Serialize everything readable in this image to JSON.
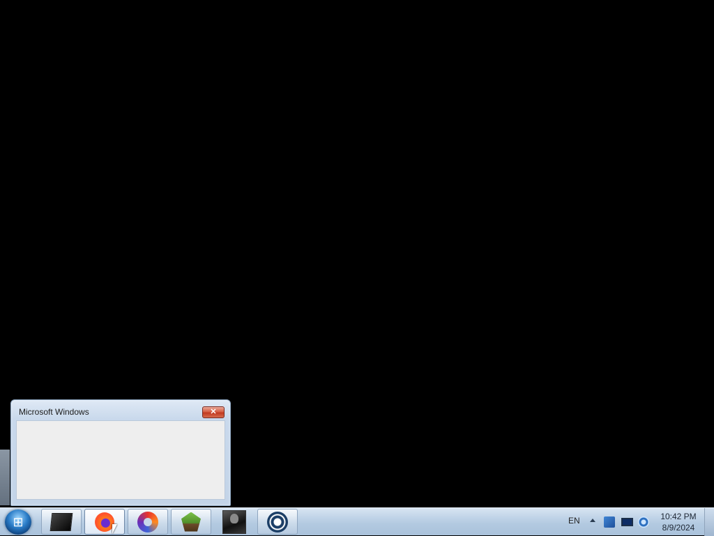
{
  "preview": {
    "title": "Microsoft Windows",
    "close_glyph": "✕"
  },
  "taskbar": {
    "start_glyph": "⊞",
    "pinned": [
      {
        "name": "dark-app-icon"
      },
      {
        "name": "firefox-icon"
      },
      {
        "name": "swirl-app-icon"
      },
      {
        "name": "green-gem-icon"
      },
      {
        "name": "soldier-game-icon"
      },
      {
        "name": "steam-icon"
      }
    ]
  },
  "tray": {
    "language": "EN",
    "time": "10:42 PM",
    "date": "8/9/2024"
  }
}
